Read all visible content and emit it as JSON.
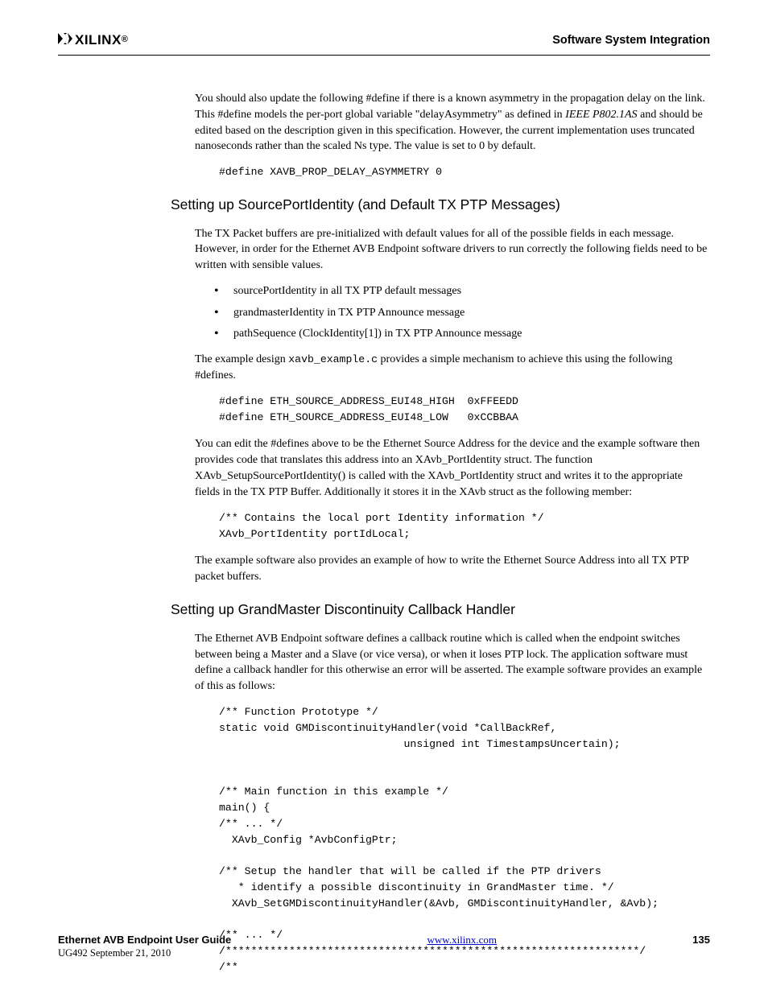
{
  "header": {
    "logo_text": "XILINX",
    "title": "Software System Integration"
  },
  "para1": "You should also update the following #define if there is a known asymmetry in the propagation delay on the link. This #define models the per-port global variable \"delayAsymmetry\" as defined in ",
  "para1_italic": "IEEE P802.1AS",
  "para1_tail": " and should be edited based on the description given in this specification. However, the current implementation uses truncated nanoseconds rather than the scaled Ns type. The value is set to 0 by default.",
  "code1": "#define XAVB_PROP_DELAY_ASYMMETRY 0",
  "section1": "Setting up SourcePortIdentity (and Default TX PTP Messages)",
  "para2": "The TX Packet buffers are pre-initialized with default values for all of the possible fields in each message. However, in order for the Ethernet AVB Endpoint software drivers to run correctly the following fields need to be written with sensible values.",
  "bullets": [
    "sourcePortIdentity in all TX PTP default messages",
    "grandmasterIdentity in TX PTP Announce message",
    "pathSequence (ClockIdentity[1]) in TX PTP Announce message"
  ],
  "para3_a": "The example design ",
  "para3_mono": "xavb_example.c",
  "para3_b": " provides a simple mechanism to achieve this using the following #defines.",
  "code2": "#define ETH_SOURCE_ADDRESS_EUI48_HIGH  0xFFEEDD\n#define ETH_SOURCE_ADDRESS_EUI48_LOW   0xCCBBAA",
  "para4": "You can edit the #defines above to be the Ethernet Source Address for the device and the example software then provides code that translates this address into an XAvb_PortIdentity struct. The function XAvb_SetupSourcePortIdentity() is called with the XAvb_PortIdentity struct and writes it to the appropriate fields in the TX PTP Buffer. Additionally it stores it in the XAvb struct as the following member:",
  "code3": "/** Contains the local port Identity information */\nXAvb_PortIdentity portIdLocal;",
  "para5": "The example software also provides an example of how to write the Ethernet Source Address into all TX PTP packet buffers.",
  "section2": "Setting up GrandMaster Discontinuity Callback Handler",
  "para6": "The Ethernet AVB Endpoint software defines a callback routine which is called when the endpoint switches between being a Master and a Slave (or vice versa), or when it loses PTP lock. The application software must define a callback handler for this otherwise an error will be asserted. The example software provides an example of this as follows:",
  "code4": "/** Function Prototype */\nstatic void GMDiscontinuityHandler(void *CallBackRef,\n                             unsigned int TimestampsUncertain);\n\n\n/** Main function in this example */\nmain() {\n/** ... */\n  XAvb_Config *AvbConfigPtr;\n\n/** Setup the handler that will be called if the PTP drivers\n   * identify a possible discontinuity in GrandMaster time. */\n  XAvb_SetGMDiscontinuityHandler(&Avb, GMDiscontinuityHandler, &Avb);\n\n/** ... */\n/*****************************************************************/\n/**",
  "footer": {
    "title": "Ethernet AVB Endpoint User Guide",
    "sub": "UG492 September 21, 2010",
    "link": "www.xilinx.com",
    "page": "135"
  }
}
